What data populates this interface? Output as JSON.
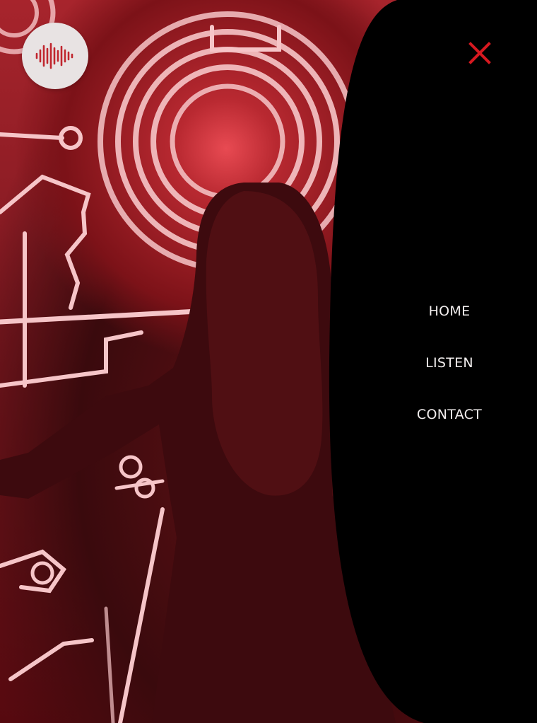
{
  "logo": {
    "icon": "soundwave-icon"
  },
  "menu": {
    "close_icon": "close-icon",
    "items": [
      {
        "label": "HOME"
      },
      {
        "label": "LISTEN"
      },
      {
        "label": "CONTACT"
      }
    ]
  },
  "colors": {
    "panel": "#000000",
    "accent": "#d71920",
    "menu_text": "#f2eeee",
    "photo_tint": "#a7242c"
  }
}
